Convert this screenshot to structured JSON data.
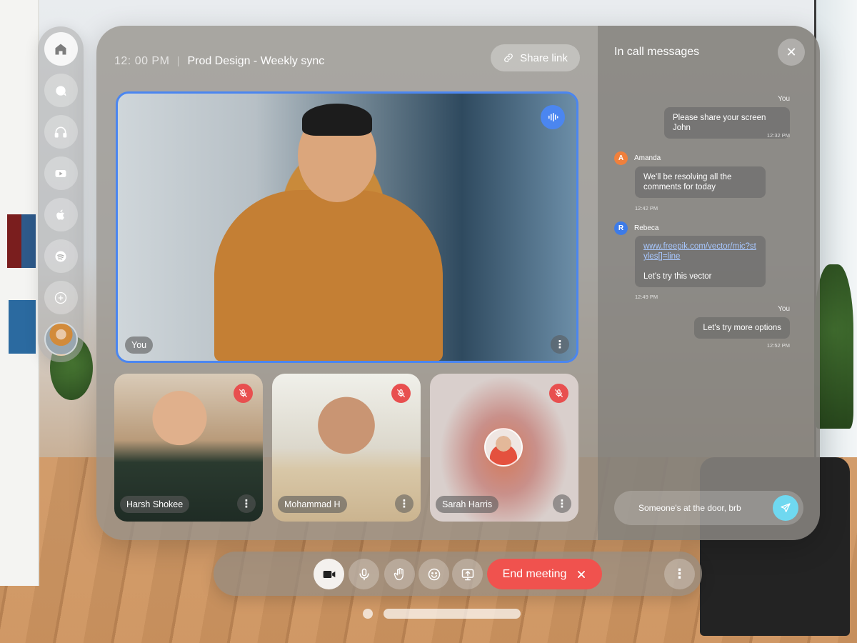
{
  "header": {
    "time": "12: 00 PM",
    "meeting_title": "Prod Design - Weekly sync",
    "share_label": "Share link"
  },
  "dock": {
    "items": [
      {
        "name": "home-icon"
      },
      {
        "name": "chat-icon"
      },
      {
        "name": "headphones-icon"
      },
      {
        "name": "youtube-icon"
      },
      {
        "name": "apple-icon"
      },
      {
        "name": "spotify-icon"
      },
      {
        "name": "add-icon"
      }
    ]
  },
  "main_video": {
    "label": "You"
  },
  "participants": [
    {
      "name": "Harsh Shokee",
      "muted": true
    },
    {
      "name": "Mohammad H",
      "muted": true
    },
    {
      "name": "Sarah Harris",
      "muted": true
    }
  ],
  "chat": {
    "title": "In call messages",
    "messages": [
      {
        "sender": "You",
        "text": "Please share your screen John",
        "time": "12:32 PM"
      },
      {
        "sender": "Amanda",
        "initial": "A",
        "text": "We'll be resolving all the comments for today",
        "time": "12:42 PM"
      },
      {
        "sender": "Rebeca",
        "initial": "R",
        "link": "www.freepik.com/vector/mic?styles[]=line",
        "text": "Let's try this vector",
        "time": "12:49 PM"
      },
      {
        "sender": "You",
        "text": "Let's try more options",
        "time": "12:52 PM"
      }
    ],
    "input_value": "Someone's at the door, brb"
  },
  "controls": {
    "end_label": "End meeting"
  },
  "colors": {
    "accent_blue": "#4b86f0",
    "end_red": "#f0524e",
    "send_cyan": "#6fd8f0",
    "amanda_orange": "#f0803c",
    "rebeca_blue": "#3d7be8"
  }
}
